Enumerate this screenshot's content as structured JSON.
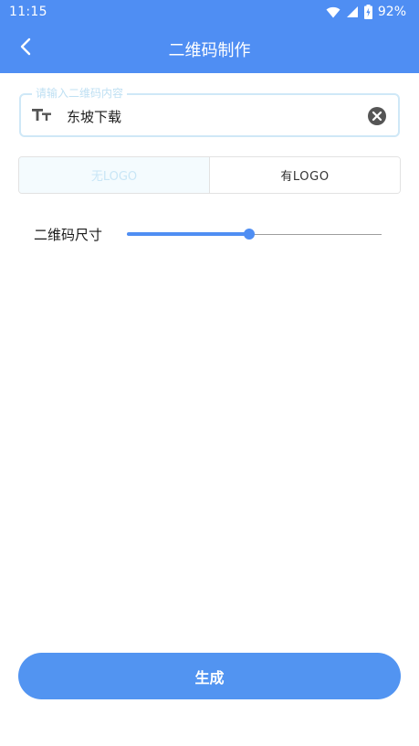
{
  "status_bar": {
    "time": "11:15",
    "battery_percent": "92%",
    "icons": [
      "wifi-icon",
      "signal-icon",
      "battery-charging-icon"
    ]
  },
  "appbar": {
    "title": "二维码制作",
    "back_icon": "chevron-left-icon"
  },
  "content_field": {
    "label": "请输入二维码内容",
    "value": "东坡下载",
    "leading_icon": "text-format-icon",
    "trailing_icon": "clear-circle-icon"
  },
  "logo_toggle": {
    "options": [
      {
        "label": "无LOGO",
        "selected": false
      },
      {
        "label": "有LOGO",
        "selected": true
      }
    ]
  },
  "size_slider": {
    "label": "二维码尺寸",
    "value_fraction": 0.48
  },
  "generate_button": {
    "label": "生成"
  },
  "colors": {
    "primary": "#4f8ef3",
    "button": "#5294f1",
    "field_border": "#cfe8f7"
  }
}
